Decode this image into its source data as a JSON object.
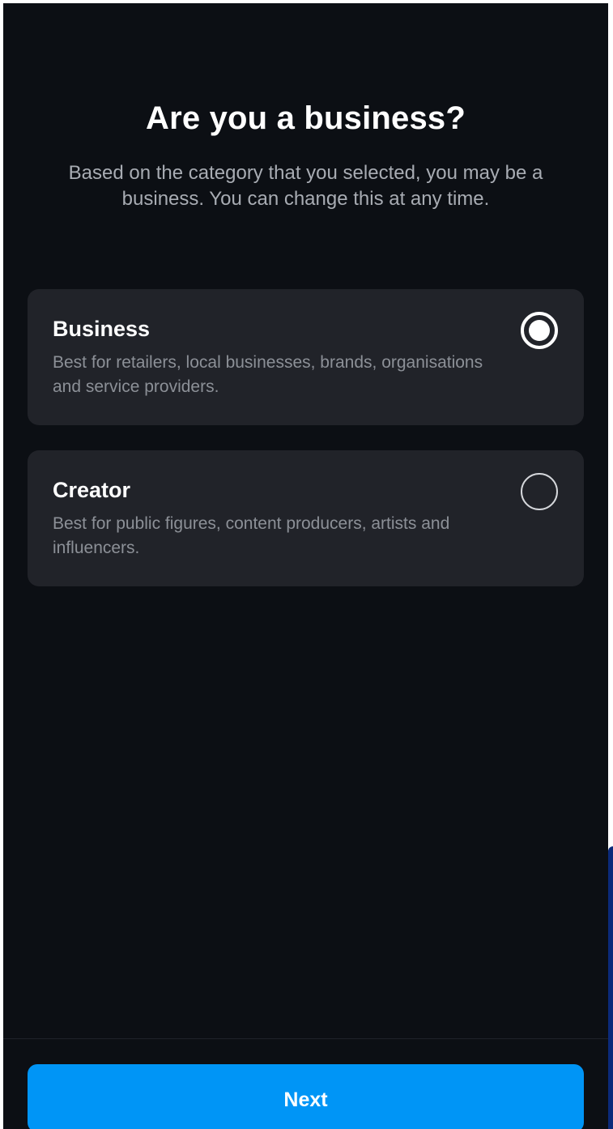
{
  "header": {
    "title": "Are you a business?",
    "subtitle": "Based on the category that you selected, you may be a business. You can change this at any time."
  },
  "options": [
    {
      "title": "Business",
      "description": "Best for retailers, local businesses, brands, organisations and service providers.",
      "selected": true
    },
    {
      "title": "Creator",
      "description": "Best for public figures, content producers, artists and influencers.",
      "selected": false
    }
  ],
  "footer": {
    "next_label": "Next"
  },
  "colors": {
    "background": "#0c0f14",
    "card": "#212329",
    "primary_button": "#0095f6",
    "title_text": "#ffffff",
    "secondary_text": "#8c9097"
  }
}
